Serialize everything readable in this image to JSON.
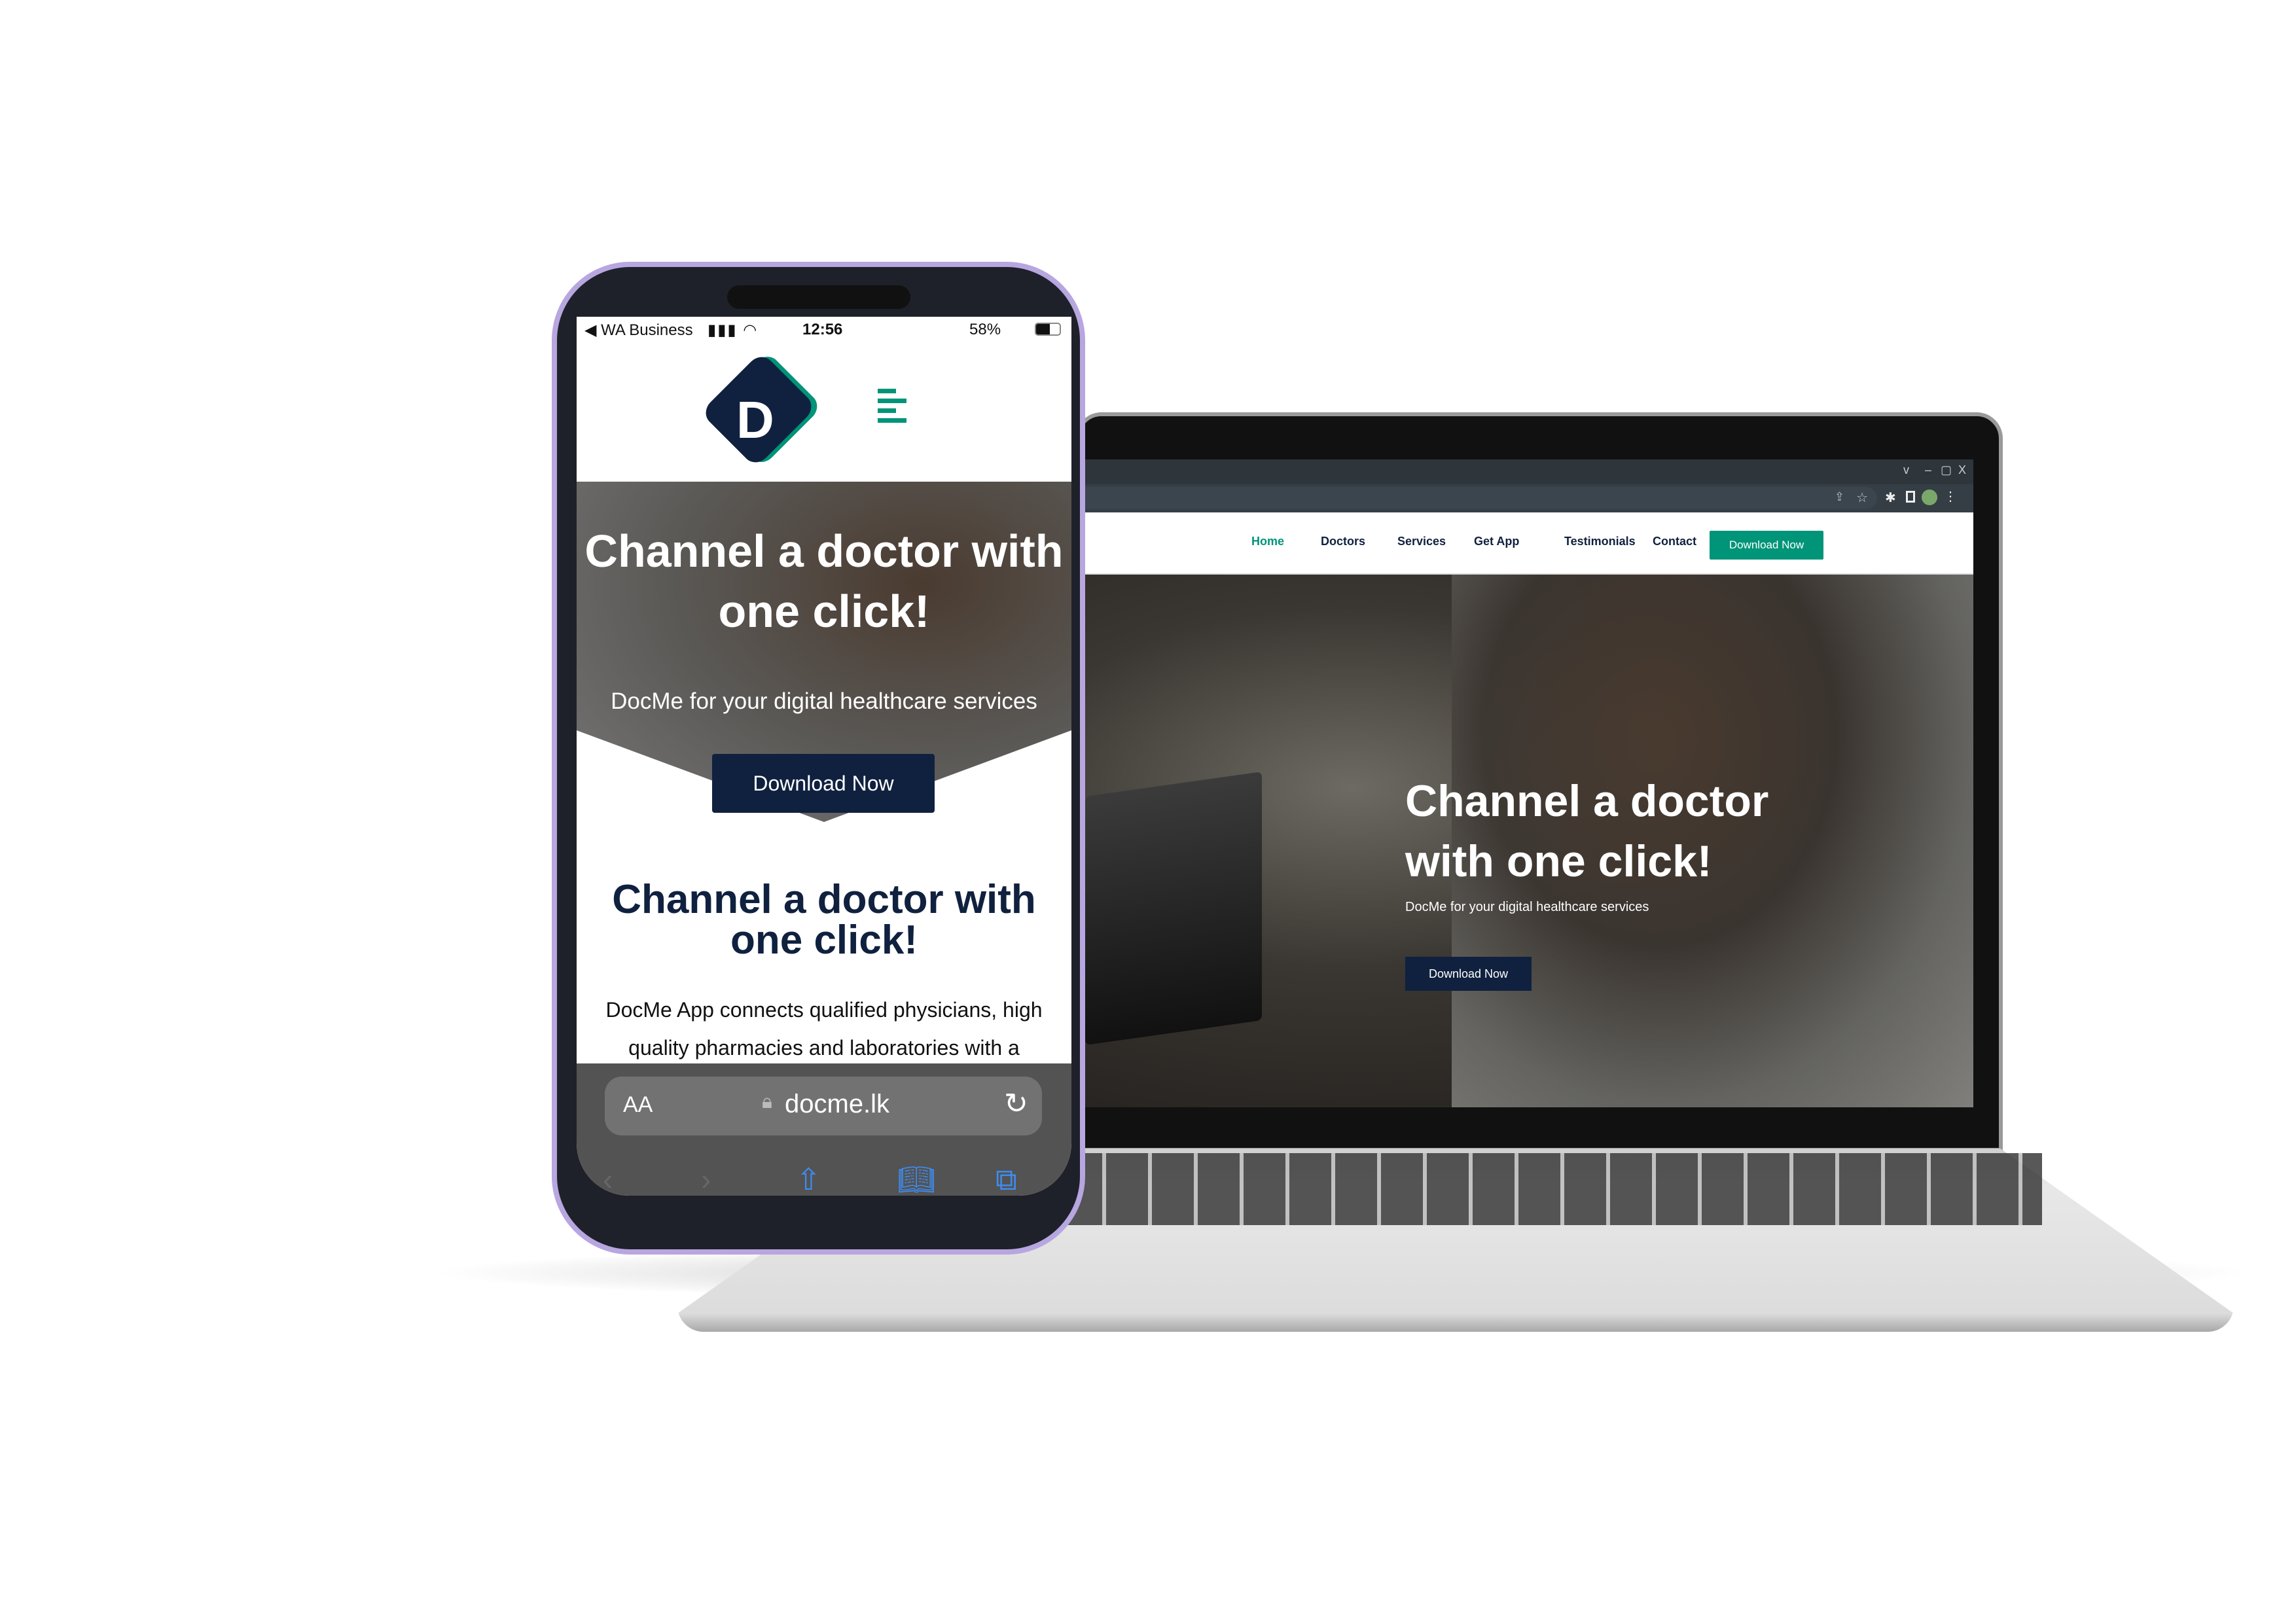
{
  "laptop": {
    "window_controls": [
      "v",
      "–",
      "▢",
      "X"
    ],
    "nav": {
      "items": [
        "Home",
        "Doctors",
        "Services",
        "Get App",
        "Testimonials",
        "Contact"
      ],
      "active": "Home",
      "cta": "Download Now"
    },
    "hero": {
      "title_line1": "Channel a doctor",
      "title_line2": "with one click!",
      "subtitle": "DocMe for your digital healthcare services",
      "button": "Download Now"
    }
  },
  "phone": {
    "status": {
      "carrier": "◀ WA Business",
      "time": "12:56",
      "battery": "58%"
    },
    "hero": {
      "title": "Channel a doctor with one click!",
      "subtitle": "DocMe for your digital healthcare services",
      "button": "Download Now"
    },
    "section": {
      "title": "Channel a doctor with one click!",
      "text": "DocMe App connects qualified physicians, high quality pharmacies and laboratories with a"
    },
    "browser": {
      "text_size": "AA",
      "url": "docme.lk"
    }
  },
  "colors": {
    "brand_navy": "#10213f",
    "brand_green": "#009479",
    "phone_frame": "#b7a6e0"
  }
}
